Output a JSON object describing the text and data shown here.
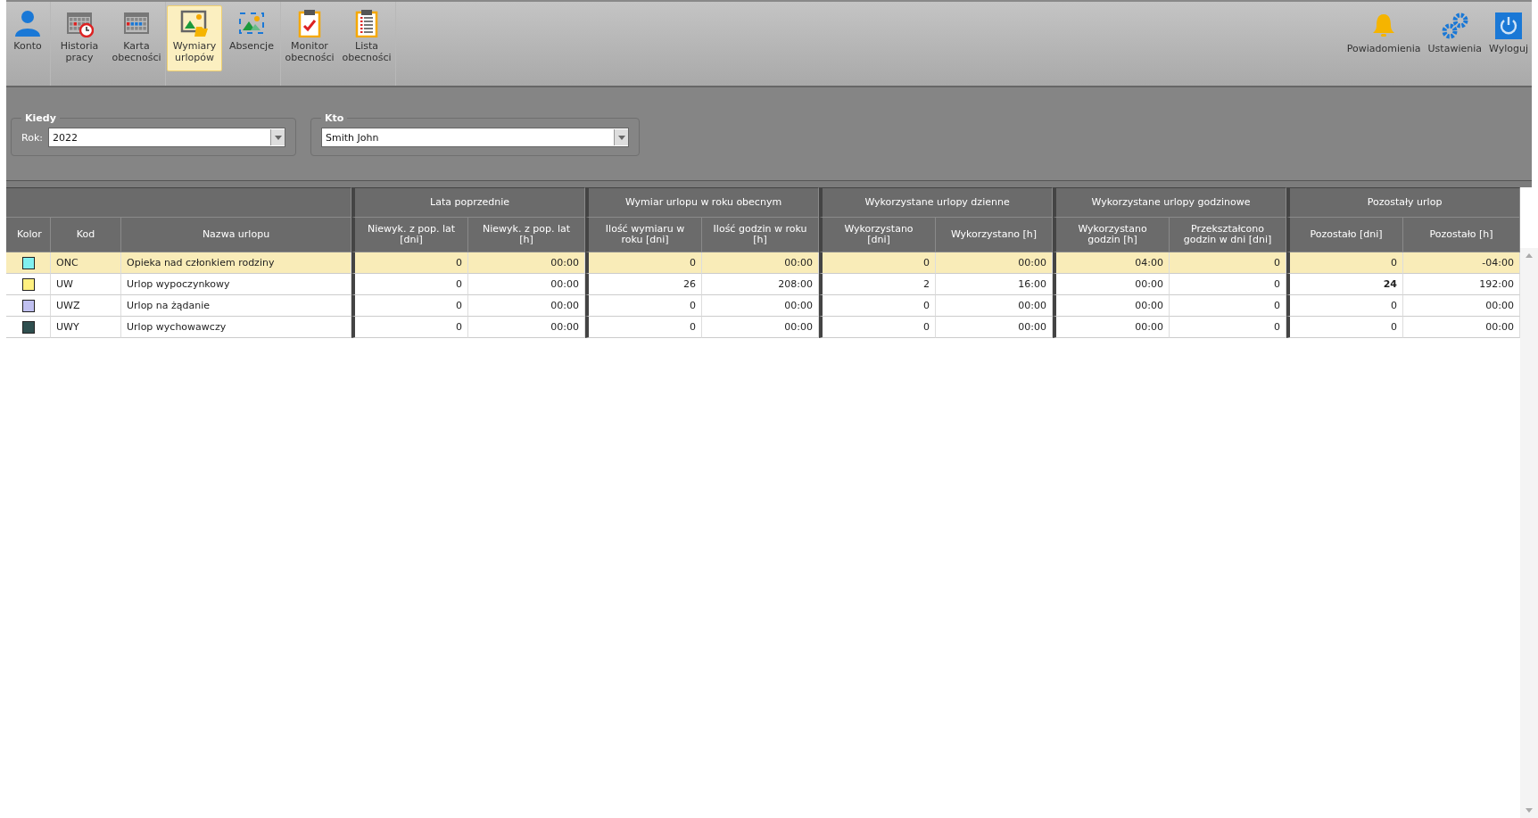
{
  "toolbar": {
    "groups": [
      {
        "items": [
          {
            "kind": "person",
            "label": "Konto",
            "selected": false
          }
        ]
      },
      {
        "items": [
          {
            "kind": "calendar-clock",
            "label": "Historia pracy",
            "selected": false
          },
          {
            "kind": "calendar",
            "label": "Karta obecności",
            "selected": false
          }
        ]
      },
      {
        "items": [
          {
            "kind": "image-folder",
            "label": "Wymiary urlopów",
            "selected": true
          },
          {
            "kind": "image-frame",
            "label": "Absencje",
            "selected": false
          }
        ]
      },
      {
        "items": [
          {
            "kind": "clipboard-check",
            "label": "Monitor obecności",
            "selected": false
          },
          {
            "kind": "clipboard-list",
            "label": "Lista obecności",
            "selected": false
          }
        ]
      }
    ],
    "right_items": [
      {
        "kind": "bell",
        "label": "Powiadomienia"
      },
      {
        "kind": "gears",
        "label": "Ustawienia"
      },
      {
        "kind": "power",
        "label": "Wyloguj"
      }
    ]
  },
  "filters": [
    {
      "legend": "Kiedy",
      "label": "Rok:",
      "value": "2022"
    },
    {
      "legend": "Kto",
      "value": "Smith John"
    }
  ],
  "table": {
    "fixed_columns": [
      "Kolor",
      "Kod",
      "Nazwa urlopu"
    ],
    "groups": [
      {
        "title": "Lata poprzednie",
        "columns": [
          "Niewyk. z pop. lat [dni]",
          "Niewyk. z pop. lat [h]"
        ]
      },
      {
        "title": "Wymiar urlopu w roku obecnym",
        "columns": [
          "Ilość wymiaru w roku [dni]",
          "Ilość godzin w roku [h]"
        ]
      },
      {
        "title": "Wykorzystane urlopy dzienne",
        "columns": [
          "Wykorzystano [dni]",
          "Wykorzystano [h]"
        ]
      },
      {
        "title": "Wykorzystane urlopy godzinowe",
        "columns": [
          "Wykorzystano godzin [h]",
          "Przekształcono godzin w dni [dni]"
        ]
      },
      {
        "title": "Pozostały urlop",
        "columns": [
          "Pozostało [dni]",
          "Pozostało [h]"
        ]
      }
    ],
    "rows": [
      {
        "color": "#80f0f0",
        "code": "ONC",
        "name": "Opieka nad członkiem rodziny",
        "selected": true,
        "cells": [
          {
            "text": "0",
            "bold": false
          },
          {
            "text": "00:00",
            "bold": false
          },
          {
            "text": "0",
            "bold": false
          },
          {
            "text": "00:00",
            "bold": false
          },
          {
            "text": "0",
            "bold": false
          },
          {
            "text": "00:00",
            "bold": false
          },
          {
            "text": "04:00",
            "bold": false
          },
          {
            "text": "0",
            "bold": false
          },
          {
            "text": "0",
            "bold": false
          },
          {
            "text": "-04:00",
            "bold": false
          }
        ]
      },
      {
        "color": "#fff080",
        "code": "UW",
        "name": "Urlop wypoczynkowy",
        "selected": false,
        "cells": [
          {
            "text": "0",
            "bold": false
          },
          {
            "text": "00:00",
            "bold": false
          },
          {
            "text": "26",
            "bold": false
          },
          {
            "text": "208:00",
            "bold": false
          },
          {
            "text": "2",
            "bold": false
          },
          {
            "text": "16:00",
            "bold": false
          },
          {
            "text": "00:00",
            "bold": false
          },
          {
            "text": "0",
            "bold": false
          },
          {
            "text": "24",
            "bold": true
          },
          {
            "text": "192:00",
            "bold": false
          }
        ]
      },
      {
        "color": "#c0c0f0",
        "code": "UWZ",
        "name": "Urlop na żądanie",
        "selected": false,
        "cells": [
          {
            "text": "0",
            "bold": false
          },
          {
            "text": "00:00",
            "bold": false
          },
          {
            "text": "0",
            "bold": false
          },
          {
            "text": "00:00",
            "bold": false
          },
          {
            "text": "0",
            "bold": false
          },
          {
            "text": "00:00",
            "bold": false
          },
          {
            "text": "00:00",
            "bold": false
          },
          {
            "text": "0",
            "bold": false
          },
          {
            "text": "0",
            "bold": false
          },
          {
            "text": "00:00",
            "bold": false
          }
        ]
      },
      {
        "color": "#2f4f4f",
        "code": "UWY",
        "name": "Urlop wychowawczy",
        "selected": false,
        "cells": [
          {
            "text": "0",
            "bold": false
          },
          {
            "text": "00:00",
            "bold": false
          },
          {
            "text": "0",
            "bold": false
          },
          {
            "text": "00:00",
            "bold": false
          },
          {
            "text": "0",
            "bold": false
          },
          {
            "text": "00:00",
            "bold": false
          },
          {
            "text": "00:00",
            "bold": false
          },
          {
            "text": "0",
            "bold": false
          },
          {
            "text": "0",
            "bold": false
          },
          {
            "text": "00:00",
            "bold": false
          }
        ]
      }
    ]
  }
}
